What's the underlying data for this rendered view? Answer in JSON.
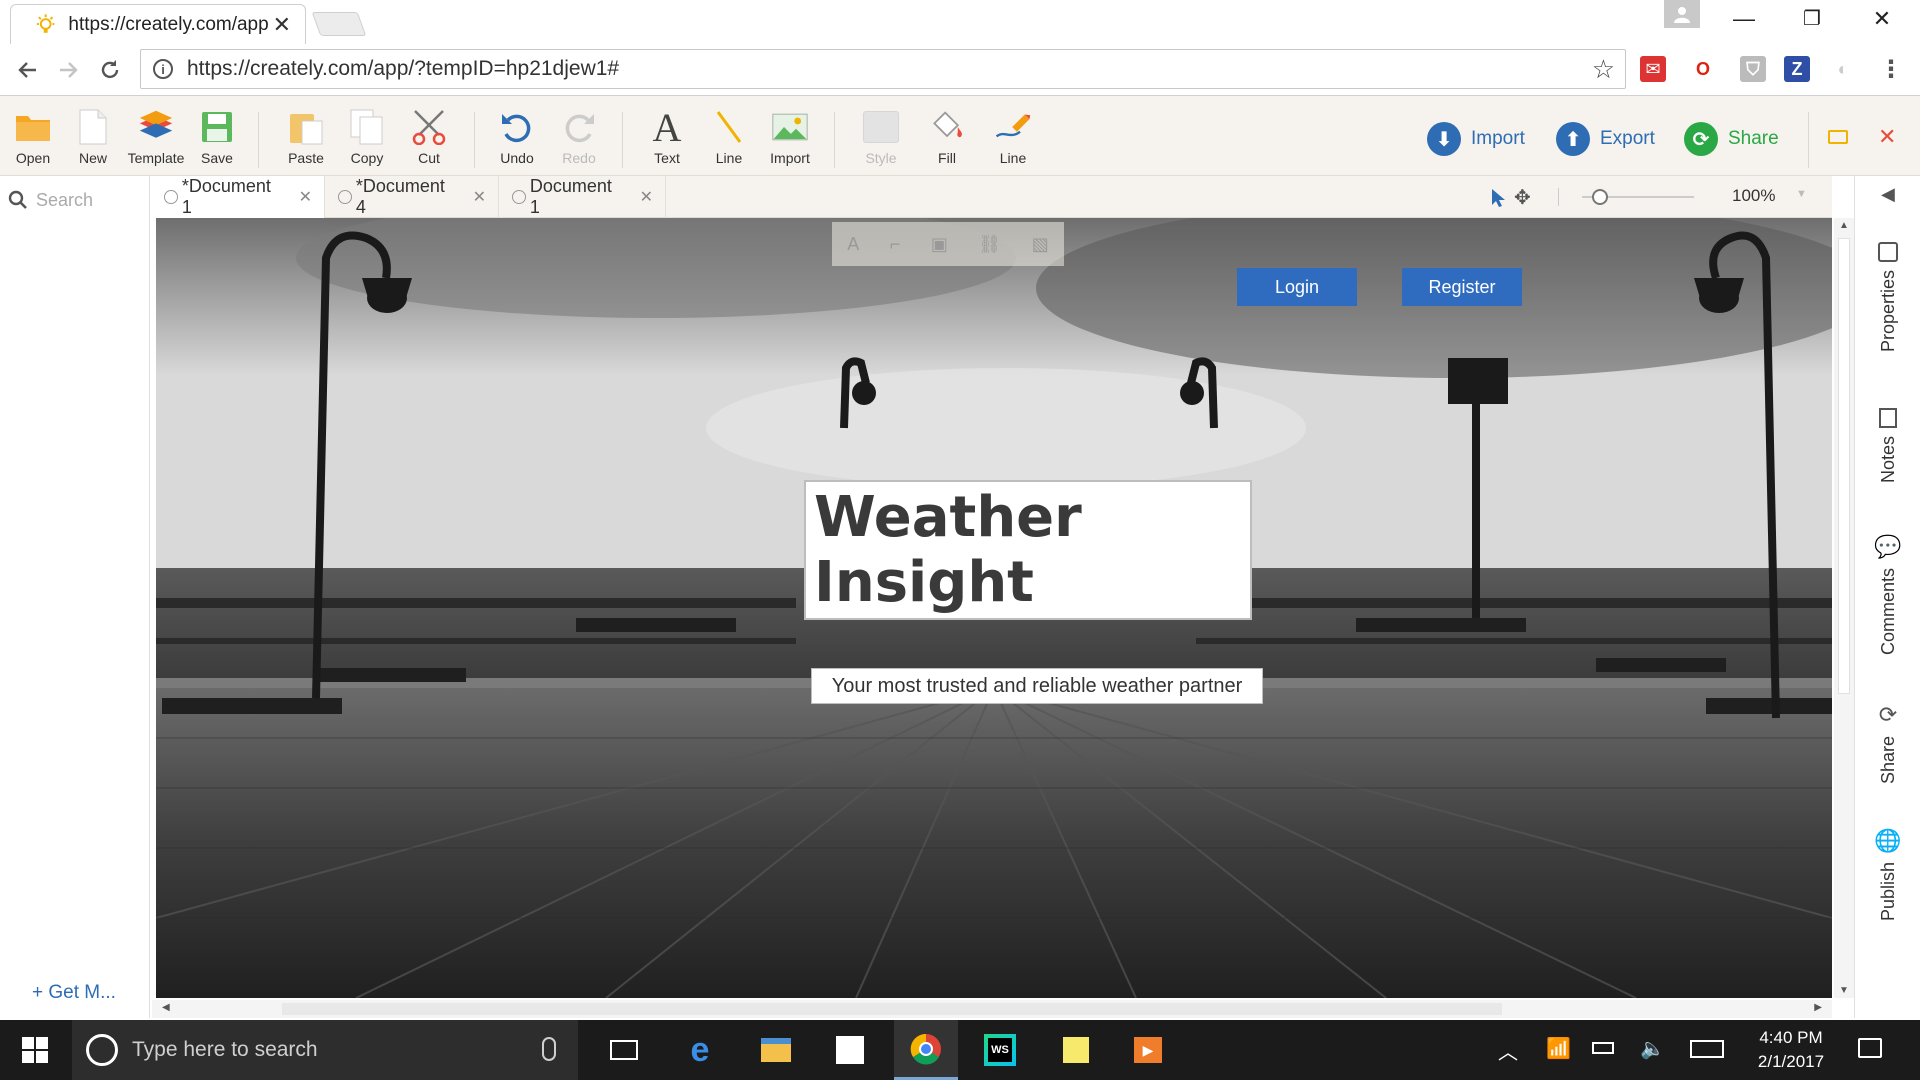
{
  "browser": {
    "tab_title": "https://creately.com/app",
    "address": "https://creately.com/app/?tempID=hp21djew1#"
  },
  "toolbar": {
    "tools": [
      {
        "label": "Open",
        "icon": "folder-icon"
      },
      {
        "label": "New",
        "icon": "new-doc-icon"
      },
      {
        "label": "Template",
        "icon": "template-stack-icon"
      },
      {
        "label": "Save",
        "icon": "save-icon"
      },
      {
        "label": "Paste",
        "icon": "paste-icon"
      },
      {
        "label": "Copy",
        "icon": "copy-icon"
      },
      {
        "label": "Cut",
        "icon": "scissors-icon"
      },
      {
        "label": "Undo",
        "icon": "undo-icon"
      },
      {
        "label": "Redo",
        "icon": "redo-icon"
      },
      {
        "label": "Text",
        "icon": "text-icon"
      },
      {
        "label": "Line",
        "icon": "line-icon"
      },
      {
        "label": "Import",
        "icon": "image-import-icon"
      },
      {
        "label": "Style",
        "icon": "style-icon"
      },
      {
        "label": "Fill",
        "icon": "fill-bucket-icon"
      },
      {
        "label": "Line",
        "icon": "line-pen-icon"
      }
    ],
    "import_label": "Import",
    "export_label": "Export",
    "share_label": "Share"
  },
  "left_panel": {
    "search_placeholder": "Search",
    "get_more": "+ Get M..."
  },
  "doc_tabs": [
    {
      "label": "*Document 1",
      "active": true
    },
    {
      "label": "*Document 4",
      "active": false
    },
    {
      "label": "Document 1",
      "active": false
    }
  ],
  "zoom": "100%",
  "canvas": {
    "login_label": "Login",
    "register_label": "Register",
    "headline": "Weather Insight",
    "tagline": "Your most trusted and reliable weather partner"
  },
  "right_panel": {
    "tabs": [
      "Properties",
      "Notes",
      "Comments",
      "Share",
      "Publish"
    ]
  },
  "taskbar": {
    "search_placeholder": "Type here to search",
    "time": "4:40 PM",
    "date": "2/1/2017"
  },
  "colors": {
    "accent_blue": "#2e6db4",
    "share_green": "#2aa845",
    "canvas_button": "#2f6cc0"
  }
}
